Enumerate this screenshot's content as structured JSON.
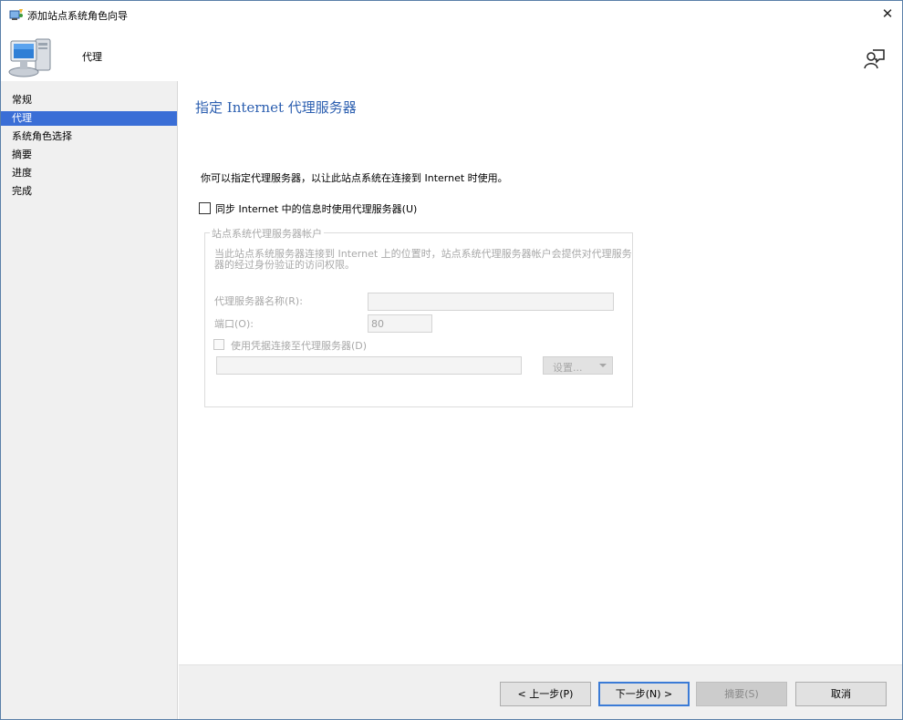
{
  "window": {
    "title": "添加站点系统角色向导",
    "close_glyph": "✕",
    "icons": {
      "app": "wizard-icon",
      "header": "computer-icon",
      "help": "help-user-icon"
    }
  },
  "header": {
    "page_name": "代理"
  },
  "sidebar": {
    "items": [
      {
        "label": "常规",
        "active": false
      },
      {
        "label": "代理",
        "active": true
      },
      {
        "label": "系统角色选择",
        "active": false
      },
      {
        "label": "摘要",
        "active": false
      },
      {
        "label": "进度",
        "active": false
      },
      {
        "label": "完成",
        "active": false
      }
    ]
  },
  "main": {
    "heading": "指定 Internet 代理服务器",
    "description": "你可以指定代理服务器，以让此站点系统在连接到 Internet 时使用。",
    "use_proxy_checkbox": {
      "label": "同步 Internet 中的信息时使用代理服务器(U)",
      "checked": false
    },
    "account_group": {
      "legend": "站点系统代理服务器帐户",
      "description": "当此站点系统服务器连接到 Internet 上的位置时，站点系统代理服务器帐户会提供对代理服务器的经过身份验证的访问权限。",
      "server_name_label": "代理服务器名称(R):",
      "server_name_value": "",
      "port_label": "端口(O):",
      "port_value": "80",
      "credentials_checkbox": {
        "label": "使用凭据连接至代理服务器(D)",
        "checked": false
      },
      "account_value": "",
      "set_button_label": "设置..."
    }
  },
  "footer": {
    "back_label": "< 上一步(P)",
    "next_label": "下一步(N) >",
    "summary_label": "摘要(S)",
    "cancel_label": "取消"
  },
  "colors": {
    "accent": "#3a6ed6",
    "heading": "#2c5fb0",
    "disabled_text": "#a8a8a8"
  }
}
